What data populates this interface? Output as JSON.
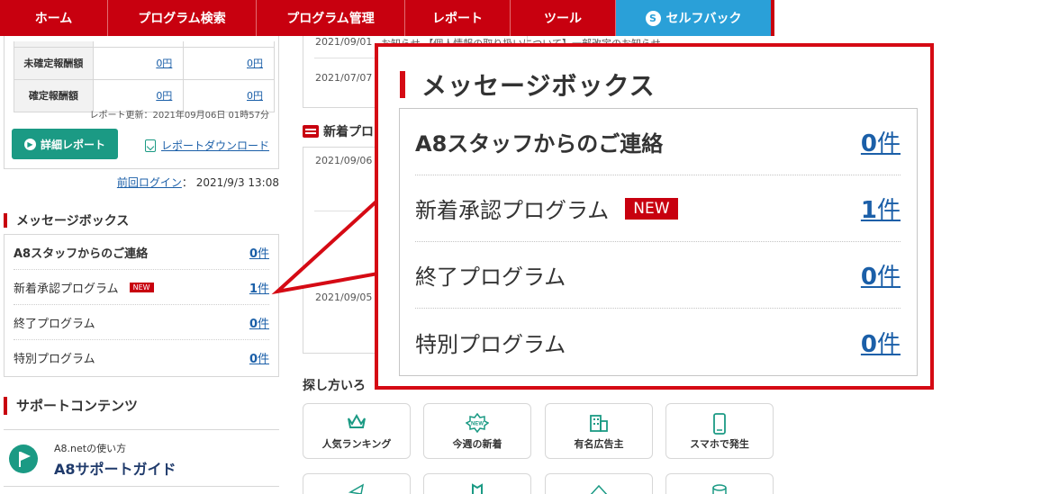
{
  "nav": {
    "items": [
      "ホーム",
      "プログラム検索",
      "プログラム管理",
      "レポート",
      "ツール"
    ],
    "selfback": "セルフバック"
  },
  "report": {
    "rows": [
      {
        "label": "未確定報酬額",
        "v1": "0円",
        "v2": "0円"
      },
      {
        "label": "確定報酬額",
        "v1": "0円",
        "v2": "0円"
      }
    ],
    "updated": "レポート更新：2021年09月06日 01時57分",
    "detail_button": "詳細レポート",
    "download_link": "レポートダウンロード",
    "last_login_label": "前回ログイン",
    "last_login_value": "：  2021/9/3 13:08"
  },
  "message_box": {
    "title": "メッセージボックス",
    "rows": [
      {
        "label": "A8スタッフからのご連絡",
        "count": "0",
        "unit": "件"
      },
      {
        "label": "新着承認プログラム",
        "badge": "NEW",
        "count": "1",
        "unit": "件"
      },
      {
        "label": "終了プログラム",
        "count": "0",
        "unit": "件"
      },
      {
        "label": "特別プログラム",
        "count": "0",
        "unit": "件"
      }
    ]
  },
  "support": {
    "title": "サポートコンテンツ",
    "item_sub": "A8.netの使い方",
    "item_main": "A8サポートガイド"
  },
  "news": {
    "top_dates": [
      "2021/09/01",
      "2021/07/07"
    ],
    "top_snippet": "お知らせ 【個人情報の取り扱いについて】一部改定のお知らせ",
    "new_title": "新着プロ",
    "new_dates": [
      "2021/09/06",
      "2021/09/05"
    ],
    "search_title": "探し方いろ"
  },
  "tiles": [
    {
      "label": "人気ランキング",
      "icon": "crown-icon"
    },
    {
      "label": "今週の新着",
      "icon": "new-badge-icon"
    },
    {
      "label": "有名広告主",
      "icon": "building-icon"
    },
    {
      "label": "スマホで発生",
      "icon": "smartphone-icon"
    }
  ],
  "callout": {
    "title": "メッセージボックス",
    "rows": [
      {
        "label": "A8スタッフからのご連絡",
        "count": "0",
        "unit": "件"
      },
      {
        "label": "新着承認プログラム",
        "badge": "NEW",
        "count": "1",
        "unit": "件"
      },
      {
        "label": "終了プログラム",
        "count": "0",
        "unit": "件"
      },
      {
        "label": "特別プログラム",
        "count": "0",
        "unit": "件"
      }
    ]
  },
  "colors": {
    "brand_red": "#c8000f",
    "selfback_blue": "#2aa0d8",
    "teal": "#1b9a84",
    "link_blue": "#1b5fa8"
  }
}
